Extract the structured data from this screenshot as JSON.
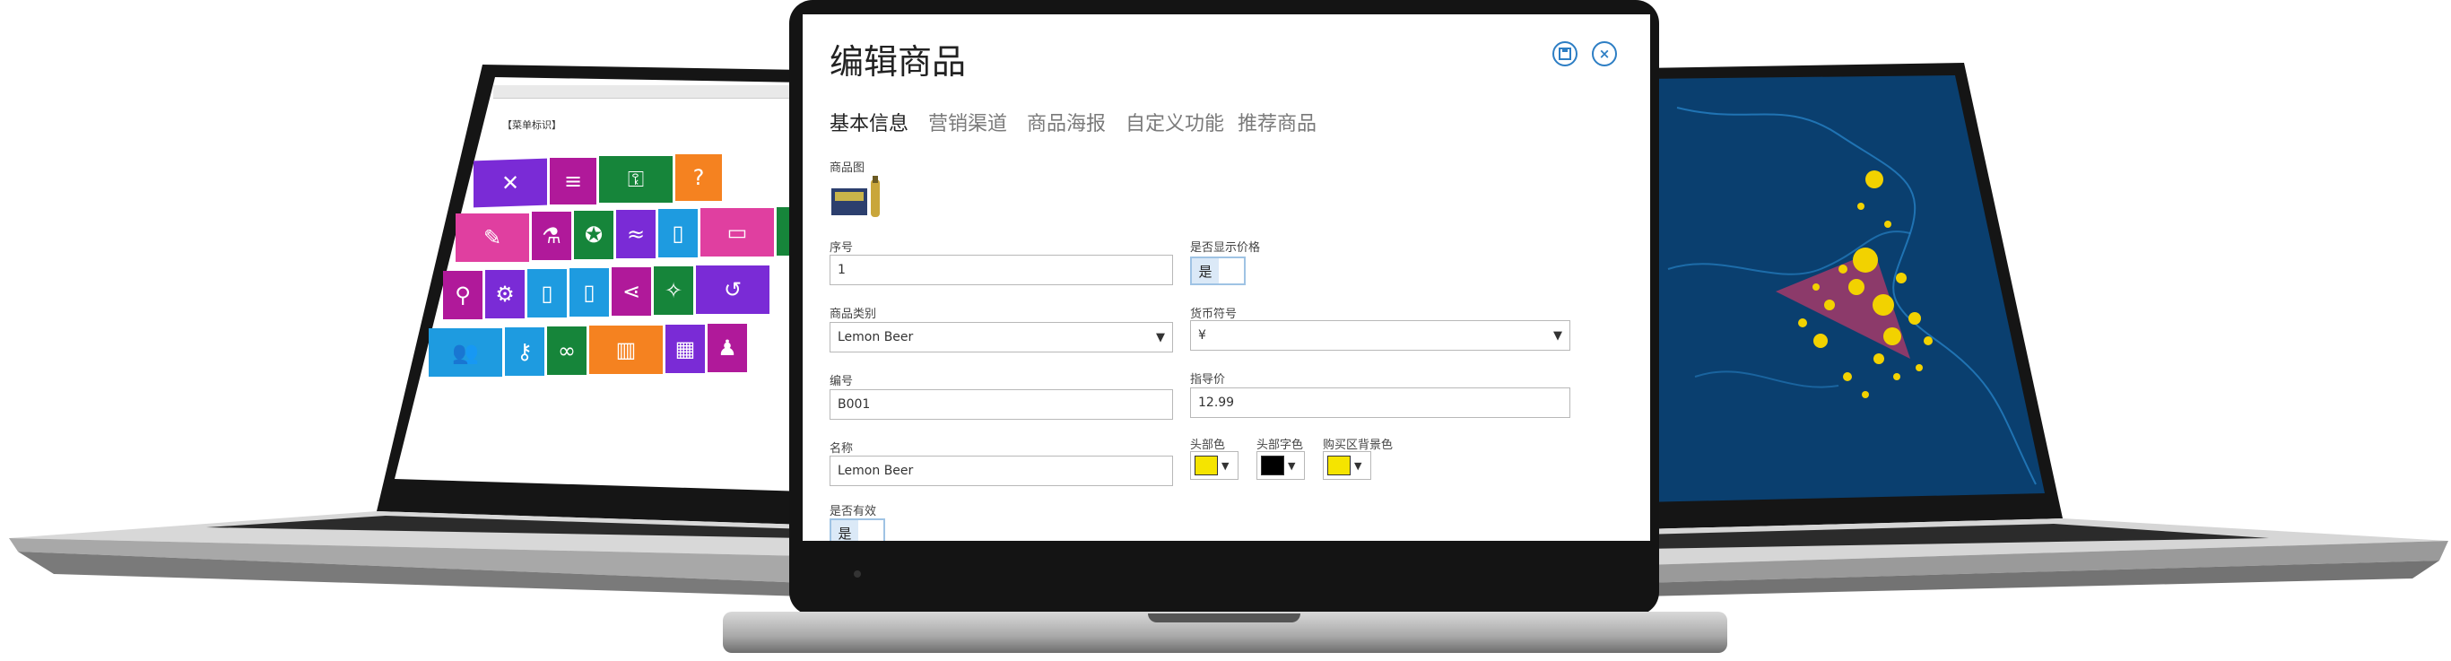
{
  "dialog": {
    "title": "编辑商品",
    "tabs": [
      {
        "label": "基本信息",
        "active": true
      },
      {
        "label": "营销渠道",
        "active": false
      },
      {
        "label": "商品海报",
        "active": false
      },
      {
        "label": "自定义功能",
        "active": false
      },
      {
        "label": "推荐商品",
        "active": false
      }
    ],
    "save_icon": "save-icon",
    "close_icon": "close-icon"
  },
  "form": {
    "image_label": "商品图",
    "serial_label": "序号",
    "serial_value": "1",
    "show_price_label": "是否显示价格",
    "show_price_value": "是",
    "category_label": "商品类别",
    "category_value": "Lemon Beer",
    "currency_label": "货币符号",
    "currency_value": "¥",
    "code_label": "编号",
    "code_value": "B001",
    "guide_price_label": "指导价",
    "guide_price_value": "12.99",
    "name_label": "名称",
    "name_value": "Lemon Beer",
    "header_color_label": "头部色",
    "header_color": "#f5e400",
    "header_font_color_label": "头部字色",
    "header_font_color": "#000000",
    "cart_bg_label": "购买区背景色",
    "cart_bg_color": "#f5e400",
    "valid_label": "是否有效",
    "valid_value": "是"
  },
  "left_laptop": {
    "header": "【菜单标识】",
    "tile_colors": [
      "#7a2bd6",
      "#b0199a",
      "#16853a",
      "#f58220",
      "#e03fa0",
      "#b0199a",
      "#16853a",
      "#7a2bd6",
      "#1e9be0",
      "#1e9be0",
      "#e03fa0",
      "#16853a",
      "#b0199a",
      "#7a2bd6",
      "#1e9be0",
      "#1e9be0",
      "#b0199a",
      "#16853a",
      "#7a2bd6",
      "#1e9be0",
      "#1e9be0",
      "#16853a",
      "#f58220",
      "#7a2bd6",
      "#b0199a"
    ]
  },
  "right_laptop": {
    "map_color": "#0a3f6f",
    "highlight_color": "#a33a6a",
    "dot_color": "#f2d200"
  }
}
